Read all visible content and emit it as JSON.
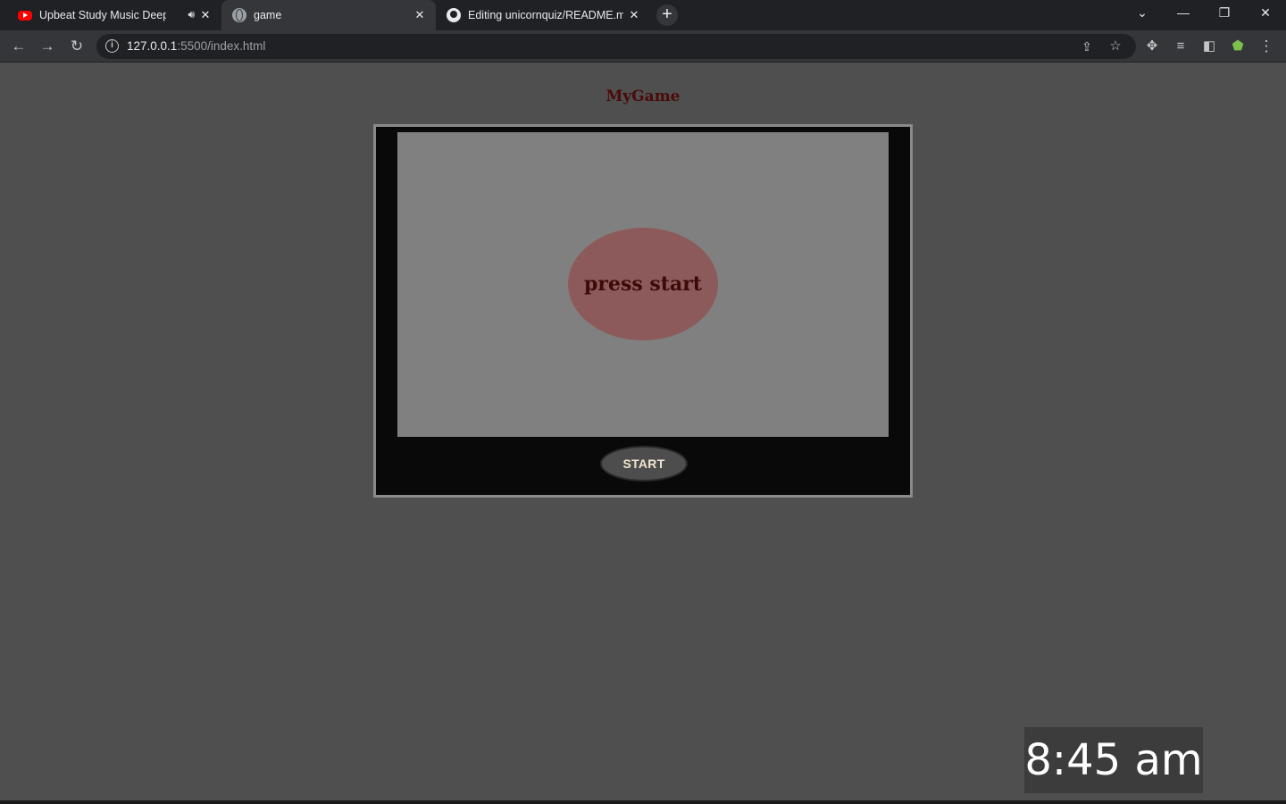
{
  "browser": {
    "tabs": [
      {
        "title": "Upbeat Study Music Deep H",
        "icon": "youtube-icon",
        "audio": true
      },
      {
        "title": "game",
        "icon": "globe-icon",
        "active": true
      },
      {
        "title": "Editing unicornquiz/README.md",
        "icon": "github-icon"
      }
    ],
    "address": {
      "host": "127.0.0.1",
      "path": ":5500/index.html"
    }
  },
  "page": {
    "title": "MyGame",
    "screen_text": "press start",
    "start_label": "START"
  },
  "taskbar": {
    "time": "8:45 am"
  },
  "colors": {
    "background": "#4f4f4f",
    "title": "#4a0a0a",
    "blob": "#8c5a5a",
    "screen": "#808080"
  }
}
